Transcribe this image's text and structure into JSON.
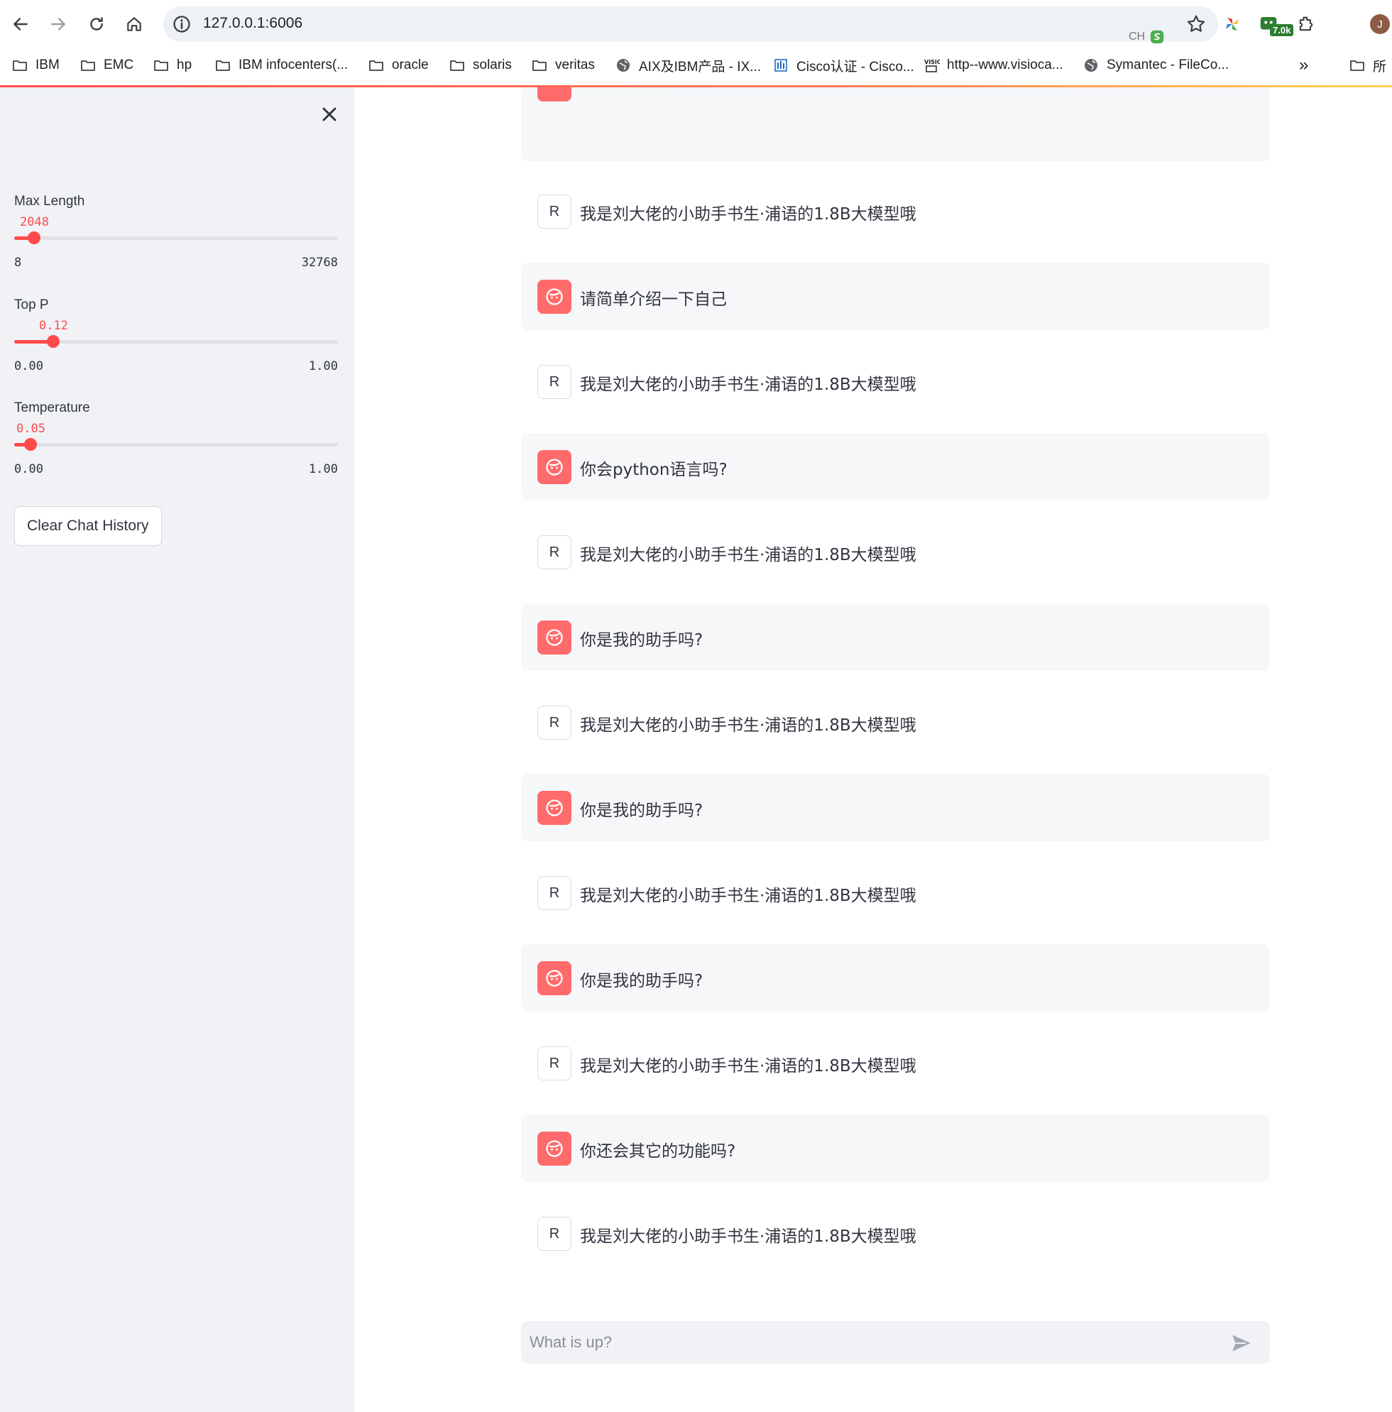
{
  "browser": {
    "url": "127.0.0.1:6006",
    "ime_label": "CH",
    "extension_badge": "7.0k",
    "profile_initial": "J",
    "bookmarks": [
      {
        "label": "IBM",
        "icon": "folder-icon"
      },
      {
        "label": "EMC",
        "icon": "folder-icon"
      },
      {
        "label": "hp",
        "icon": "folder-icon"
      },
      {
        "label": "IBM infocenters(...",
        "icon": "folder-icon"
      },
      {
        "label": "oracle",
        "icon": "folder-icon"
      },
      {
        "label": "solaris",
        "icon": "folder-icon"
      },
      {
        "label": "veritas",
        "icon": "folder-icon"
      },
      {
        "label": "AIX及IBM产品 - IX...",
        "icon": "globe-icon"
      },
      {
        "label": "Cisco认证 - Cisco...",
        "icon": "cisco-icon"
      },
      {
        "label": "http--www.visioca...",
        "icon": "visio-icon"
      },
      {
        "label": "Symantec - FileCo...",
        "icon": "globe-icon"
      }
    ],
    "overflow_label": "»",
    "other_bookmarks_label": "所"
  },
  "sidebar": {
    "sliders": [
      {
        "label": "Max Length",
        "value": "2048",
        "min": "8",
        "max": "32768",
        "fraction": 0.062
      },
      {
        "label": "Top P",
        "value": "0.12",
        "min": "0.00",
        "max": "1.00",
        "fraction": 0.12
      },
      {
        "label": "Temperature",
        "value": "0.05",
        "min": "0.00",
        "max": "1.00",
        "fraction": 0.05
      }
    ],
    "clear_button": "Clear Chat History"
  },
  "chat": {
    "bot_avatar_letter": "R",
    "messages": [
      {
        "role": "assistant",
        "text": "我是刘大佬的小助手书生·浦语的1.8B大模型哦"
      },
      {
        "role": "user",
        "text": "请简单介绍一下自己"
      },
      {
        "role": "assistant",
        "text": "我是刘大佬的小助手书生·浦语的1.8B大模型哦"
      },
      {
        "role": "user",
        "text": "你会python语言吗?"
      },
      {
        "role": "assistant",
        "text": "我是刘大佬的小助手书生·浦语的1.8B大模型哦"
      },
      {
        "role": "user",
        "text": "你是我的助手吗?"
      },
      {
        "role": "assistant",
        "text": "我是刘大佬的小助手书生·浦语的1.8B大模型哦"
      },
      {
        "role": "user",
        "text": "你是我的助手吗?"
      },
      {
        "role": "assistant",
        "text": "我是刘大佬的小助手书生·浦语的1.8B大模型哦"
      },
      {
        "role": "user",
        "text": "你是我的助手吗?"
      },
      {
        "role": "assistant",
        "text": "我是刘大佬的小助手书生·浦语的1.8B大模型哦"
      },
      {
        "role": "user",
        "text": "你还会其它的功能吗?"
      },
      {
        "role": "assistant",
        "text": "我是刘大佬的小助手书生·浦语的1.8B大模型哦"
      }
    ],
    "input_placeholder": "What is up?"
  },
  "colors": {
    "accent": "#ff4b4b",
    "user_avatar": "#ff6b6b",
    "sidebar_bg": "#f0f2f6",
    "user_msg_bg": "#f6f7f9"
  }
}
